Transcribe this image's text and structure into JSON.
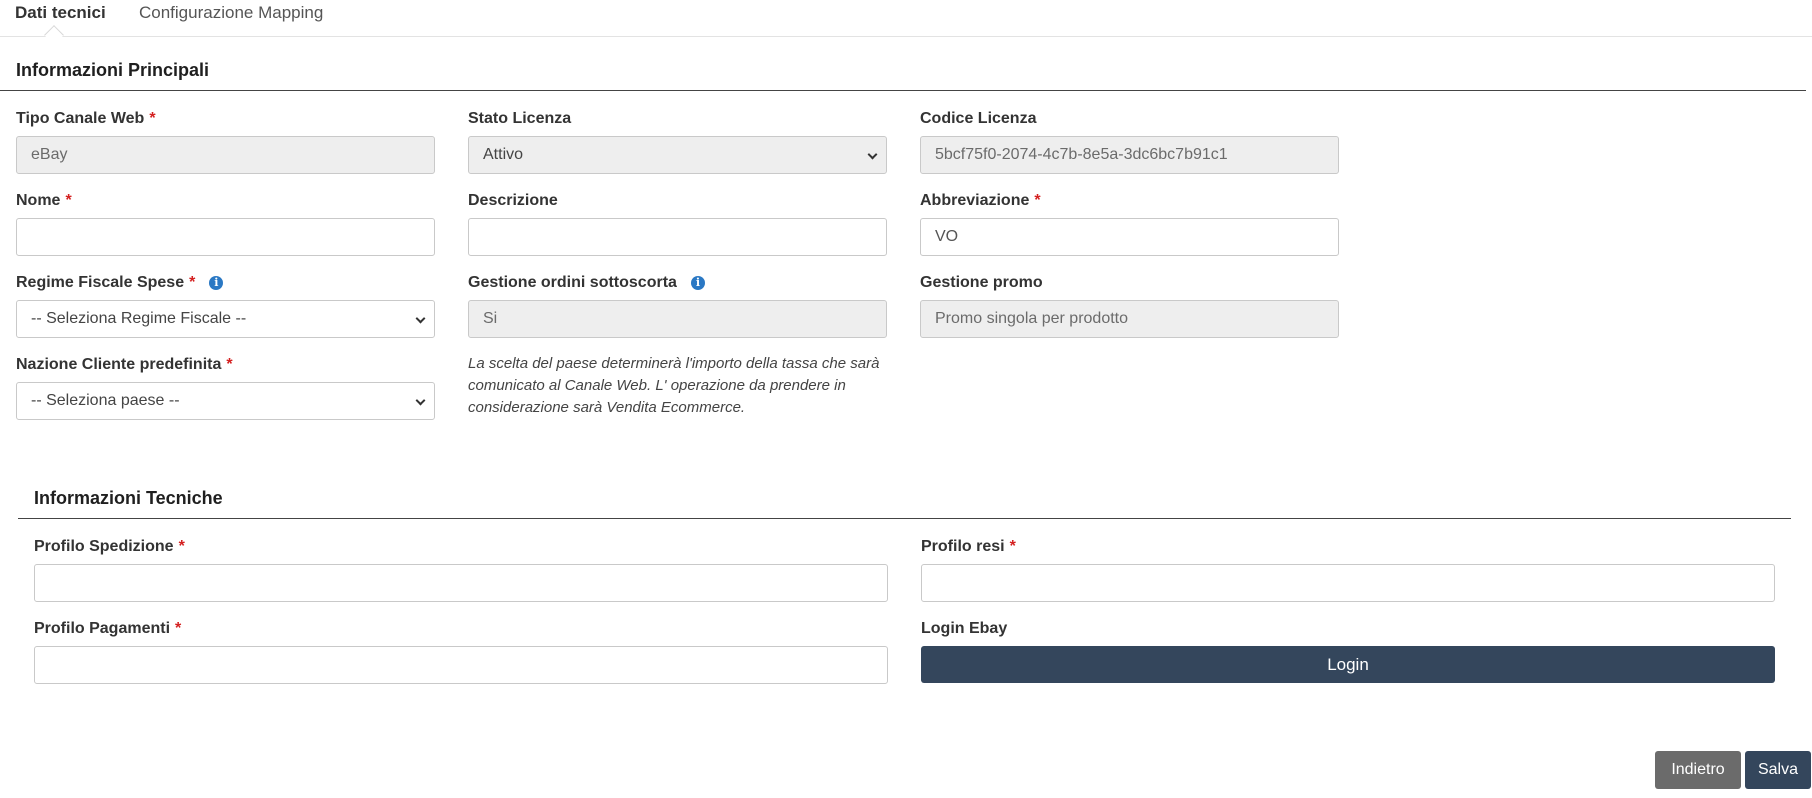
{
  "tabs": [
    {
      "label": "Dati tecnici",
      "active": true
    },
    {
      "label": "Configurazione Mapping",
      "active": false
    }
  ],
  "main_section": {
    "title": "Informazioni Principali",
    "fields": {
      "tipo_canale": {
        "label": "Tipo Canale Web",
        "required": "*",
        "value": "eBay"
      },
      "stato_licenza": {
        "label": "Stato Licenza",
        "value": "Attivo"
      },
      "codice_licenza": {
        "label": "Codice Licenza",
        "value": "5bcf75f0-2074-4c7b-8e5a-3dc6bc7b91c1"
      },
      "nome": {
        "label": "Nome",
        "required": "*",
        "value": ""
      },
      "descrizione": {
        "label": "Descrizione",
        "value": ""
      },
      "abbreviazione": {
        "label": "Abbreviazione",
        "required": "*",
        "value": "VO"
      },
      "regime_fiscale": {
        "label": "Regime Fiscale Spese",
        "required": "*",
        "value": "-- Seleziona Regime Fiscale --"
      },
      "gestione_sottoscorta": {
        "label": "Gestione ordini sottoscorta",
        "value": "Si"
      },
      "gestione_promo": {
        "label": "Gestione promo",
        "value": "Promo singola per prodotto"
      },
      "nazione_cliente": {
        "label": "Nazione Cliente predefinita",
        "required": "*",
        "value": "-- Seleziona paese --"
      }
    },
    "note": "La scelta del paese determinerà l'importo della tassa che sarà comunicato al Canale Web. L' operazione da prendere in considerazione sarà Vendita Ecommerce."
  },
  "tech_section": {
    "title": "Informazioni Tecniche",
    "fields": {
      "profilo_spedizione": {
        "label": "Profilo Spedizione",
        "required": "*",
        "value": ""
      },
      "profilo_resi": {
        "label": "Profilo resi",
        "required": "*",
        "value": ""
      },
      "profilo_pagamenti": {
        "label": "Profilo Pagamenti",
        "required": "*",
        "value": ""
      },
      "login_ebay": {
        "label": "Login Ebay",
        "button": "Login"
      }
    }
  },
  "footer": {
    "back_label": "Indietro",
    "save_label": "Salva"
  },
  "icons": {
    "info": "info-icon",
    "chevron": "chevron-down-icon"
  },
  "colors": {
    "required": "#d42020",
    "primary_button": "#34465c",
    "secondary_button": "#6b6b6b",
    "info_icon": "#2a78c4"
  }
}
